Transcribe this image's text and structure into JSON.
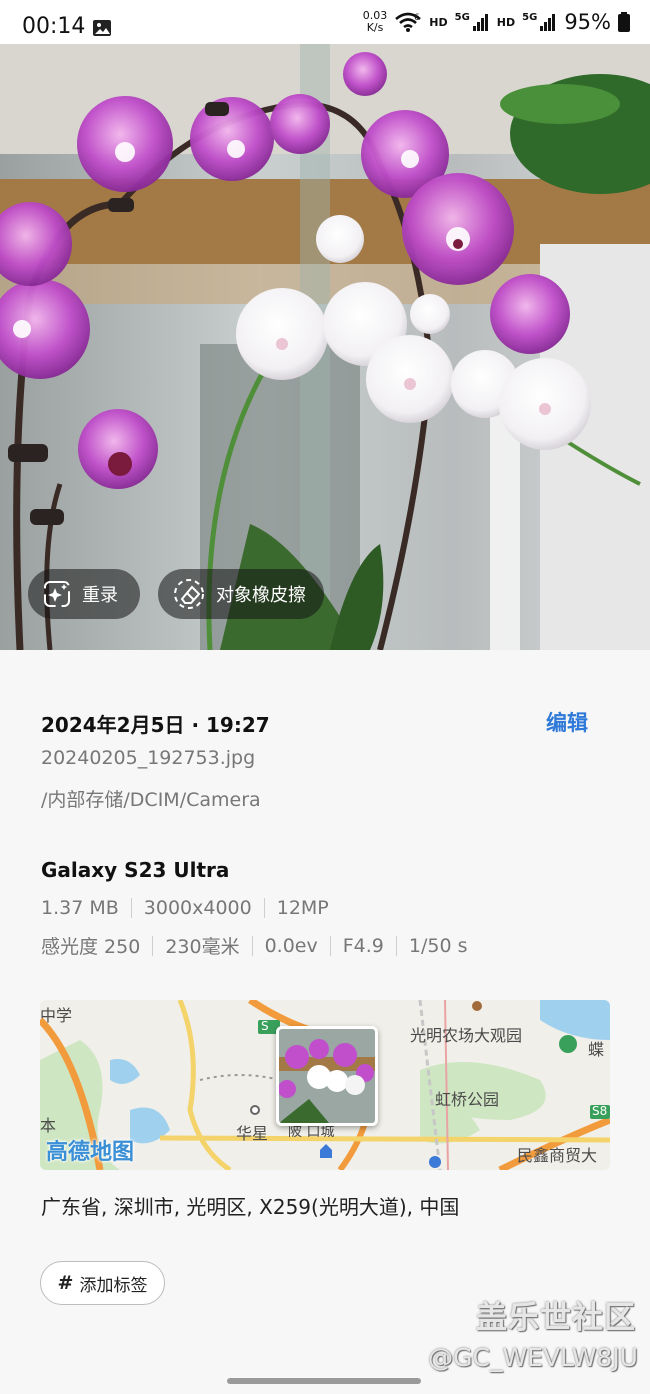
{
  "status_bar": {
    "time": "00:14",
    "net_speed_value": "0.03",
    "net_speed_unit": "K/s",
    "hd1": "HD",
    "sig1": "5G",
    "hd2": "HD",
    "sig2": "5G",
    "battery": "95%",
    "icons": [
      "gallery-icon",
      "wifi-icon",
      "signal-icon",
      "signal-icon",
      "battery-icon"
    ]
  },
  "photo_actions": {
    "remaster_label": "重录",
    "eraser_label": "对象橡皮擦"
  },
  "details": {
    "datetime": "2024年2月5日 · 19:27",
    "edit_label": "编辑",
    "file_name": "20240205_192753.jpg",
    "path": "/内部存储/DCIM/Camera",
    "device": "Galaxy S23 Ultra",
    "size": "1.37 MB",
    "resolution": "3000x4000",
    "megapixels": "12MP",
    "iso": "感光度 250",
    "focal_length": "230毫米",
    "exposure_value": "0.0ev",
    "aperture": "F4.9",
    "shutter": "1/50 s"
  },
  "map": {
    "labels": {
      "school": "中学",
      "farm": "光明农场大观园",
      "park": "虹桥公园",
      "village": "华星",
      "district": "民鑫商贸大",
      "edge_left": "本",
      "edge_right": "蝶",
      "road_s": "S",
      "road_s8": "S8",
      "near_photo": "陂 口城"
    },
    "provider_logo": "高德地图"
  },
  "address": "广东省, 深圳市, 光明区, X259(光明大道), 中国",
  "add_tag_label": "添加标签",
  "watermark": {
    "brand": "盖乐世社区",
    "user": "@GC_WEVLW8JU"
  },
  "colors": {
    "accent": "#2f7ad8",
    "background": "#f7f7f7"
  }
}
